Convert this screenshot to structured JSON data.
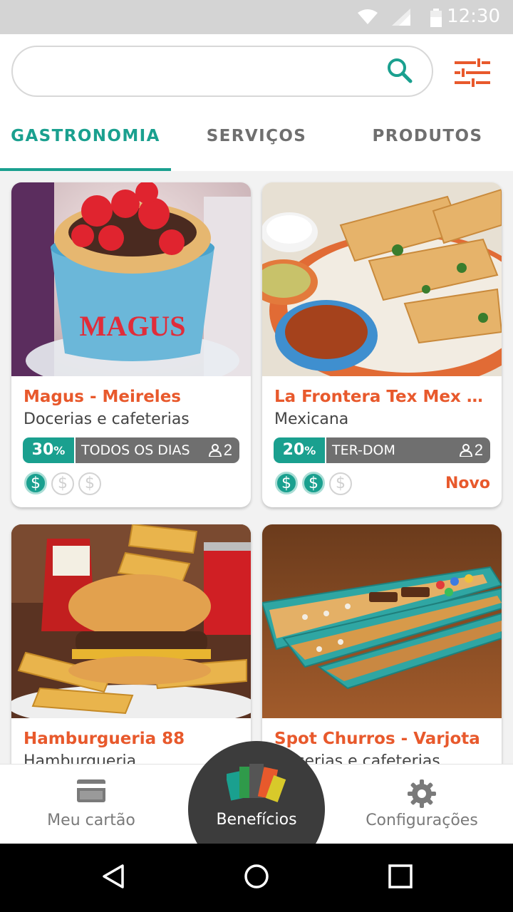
{
  "status_bar": {
    "time": "12:30"
  },
  "search": {
    "value": "",
    "placeholder": ""
  },
  "tabs": [
    {
      "label": "GASTRONOMIA",
      "active": true
    },
    {
      "label": "SERVIÇOS",
      "active": false
    },
    {
      "label": "PRODUTOS",
      "active": false
    }
  ],
  "cards": [
    {
      "title": "Magus - Meireles",
      "category": "Docerias e cafeterias",
      "discount": "30",
      "discount_unit": "%",
      "days": "TODOS OS DIAS",
      "people": "2",
      "price_level": 1,
      "price_max": 3,
      "new_label": ""
    },
    {
      "title": "La Frontera Tex Mex Gr...",
      "category": "Mexicana",
      "discount": "20",
      "discount_unit": "%",
      "days": "TER-DOM",
      "people": "2",
      "price_level": 2,
      "price_max": 3,
      "new_label": "Novo"
    },
    {
      "title": "Hamburgueria 88",
      "category": "Hamburgueria"
    },
    {
      "title": "Spot Churros - Varjota",
      "category": "Docerias e cafeterias"
    }
  ],
  "coin_symbol": "$",
  "bottom_nav": {
    "card_label": "Meu cartão",
    "benefits_label": "Benefícios",
    "settings_label": "Configurações"
  },
  "colors": {
    "accent": "#1aa08f",
    "brand_orange": "#e8592c",
    "badge_gray": "#6f6f6f",
    "nav_center": "#3c3c3c"
  },
  "icons": [
    "wifi-icon",
    "signal-icon",
    "battery-icon",
    "search-icon",
    "filter-icon",
    "person-icon",
    "credit-card-icon",
    "wallet-cards-icon",
    "gear-icon",
    "back-icon",
    "home-icon",
    "recents-icon"
  ]
}
